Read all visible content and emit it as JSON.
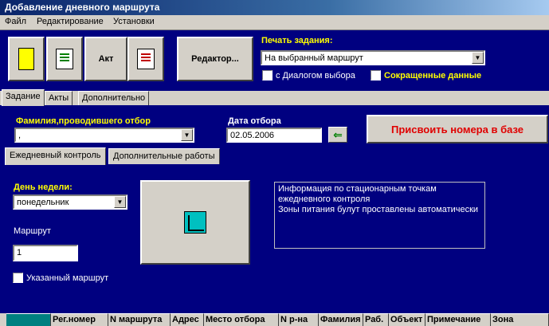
{
  "window": {
    "title": "Добавление  дневного маршрута"
  },
  "menu": [
    "Файл",
    "Редактирование",
    "Установки"
  ],
  "toolbar": {
    "akt_label": "Акт",
    "editor_label": "Редактор...",
    "print_label": "Печать задания:",
    "print_select_value": "На выбранный маршрут",
    "dialog_checkbox": {
      "label": "с Диалогом выбора",
      "checked": false
    },
    "short_checkbox": {
      "label": "Сокращенные данные",
      "checked": false
    }
  },
  "top_tabs": [
    "Задание",
    "Акты",
    "Дополнительно"
  ],
  "form": {
    "surname_label": "Фамилия,проводившего отбор",
    "surname_value": ", ",
    "date_label": "Дата отбора",
    "date_value": "02.05.2006",
    "arrow_glyph": "⇐",
    "assign_button": "Присвоить номера в базе"
  },
  "inner_tabs": [
    "Ежедневный контроль",
    "Дополнительные работы"
  ],
  "daily": {
    "weekday_label": "День недели:",
    "weekday_value": "понедельник",
    "route_label": "Маршрут",
    "route_value": "1",
    "specified_route": {
      "label": "Указанный маршрут",
      "checked": true
    },
    "info_lines": [
      "Информация по стационарным точкам",
      "ежедневного контроля",
      "Зоны питания булут проставлены автоматически"
    ]
  },
  "grid_columns": [
    "",
    "Рег.номер",
    "N маршрута",
    "Адрес",
    "Место отбора",
    "N р-на",
    "Фамилия",
    "Раб.",
    "Объект",
    "Примечание",
    "Зона"
  ],
  "colors": {
    "navy": "#000080",
    "yellow": "#ffff00",
    "red": "#e00000",
    "teal": "#008080"
  }
}
